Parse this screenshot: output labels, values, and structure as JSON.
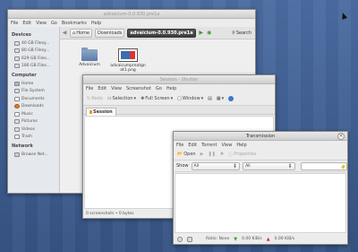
{
  "cursor": {
    "icon": "mouse-pointer-icon"
  },
  "file_manager": {
    "title": "advaicium-0.0.930.pre1a",
    "menu": [
      "File",
      "Edit",
      "View",
      "Go",
      "Bookmarks",
      "Help"
    ],
    "path": {
      "home": "Home",
      "downloads": "Downloads",
      "current": "advaicium-0.0.930.pre1a",
      "search": "Search"
    },
    "sidebar": {
      "devices_header": "Devices",
      "devices": [
        "40 GB Filesy...",
        "80 GB Filesy...",
        "629 GB Files...",
        "186 GB Files..."
      ],
      "computer_header": "Computer",
      "computer": [
        {
          "label": "Home",
          "icon": "home-icon"
        },
        {
          "label": "File System",
          "icon": "drive-icon"
        },
        {
          "label": "Documents",
          "icon": "document-icon"
        },
        {
          "label": "Downloads",
          "icon": "download-icon"
        },
        {
          "label": "Music",
          "icon": "music-icon"
        },
        {
          "label": "Pictures",
          "icon": "pictures-icon"
        },
        {
          "label": "Videos",
          "icon": "videos-icon"
        },
        {
          "label": "Trash",
          "icon": "trash-icon"
        }
      ],
      "network_header": "Network",
      "network": [
        "Browse Net..."
      ]
    },
    "files": [
      {
        "name": "Advaicium",
        "kind": "folder"
      },
      {
        "name": "advaicumpreatgnat1.png",
        "kind": "image"
      }
    ]
  },
  "shutter": {
    "title": "Session - Shutter",
    "menu": [
      "File",
      "Edit",
      "View",
      "Screenshot",
      "Go",
      "Help"
    ],
    "toolbar": {
      "redo": "Redo",
      "selection": "Selection",
      "full_screen": "Full Screen",
      "window": "Window"
    },
    "tab": "Session",
    "status": "0 screenshots • 0 bytes"
  },
  "transmission": {
    "title": "Transmission",
    "menu": [
      "File",
      "Edit",
      "Torrent",
      "View",
      "Help"
    ],
    "toolbar": {
      "open": "Open",
      "properties": "Properties"
    },
    "filter": {
      "show_label": "Show",
      "status_value": "All",
      "tracker_value": "All",
      "search_placeholder": ""
    },
    "status": {
      "ratio": "Ratio: None",
      "down": "0.00 KiB/s",
      "up": "0.00 KiB/s"
    }
  }
}
